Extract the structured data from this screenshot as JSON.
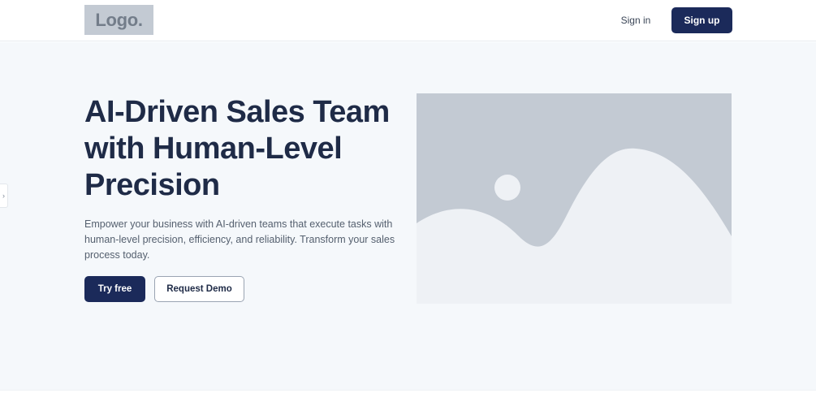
{
  "header": {
    "logo_text": "Logo.",
    "signin_label": "Sign in",
    "signup_label": "Sign up"
  },
  "hero": {
    "headline": "AI-Driven Sales Team with Human-Level Precision",
    "description": "Empower your business with AI-driven teams that execute tasks with human-level precision, efficiency, and reliability. Transform your sales process today.",
    "primary_cta": "Try free",
    "secondary_cta": "Request Demo",
    "image_icon": "image-placeholder-icon"
  },
  "side_tab": {
    "glyph": "›",
    "icon": "chevron-right-icon"
  },
  "colors": {
    "primary": "#1b2a5a",
    "hero_background": "#f5f8fb",
    "placeholder_fill": "#c3cad3",
    "placeholder_light": "#eef1f5"
  }
}
